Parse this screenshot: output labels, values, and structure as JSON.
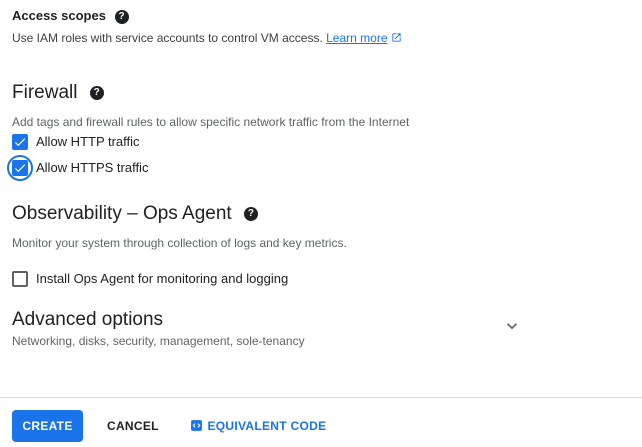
{
  "access_scopes": {
    "title": "Access scopes",
    "help_icon": "help-circle-icon",
    "description": "Use IAM roles with service accounts to control VM access.",
    "learn_more_label": "Learn more",
    "external_icon": "open-in-new-icon"
  },
  "firewall": {
    "title": "Firewall",
    "help_icon": "help-circle-icon",
    "description": "Add tags and firewall rules to allow specific network traffic from the Internet",
    "http": {
      "label": "Allow HTTP traffic",
      "checked": true
    },
    "https": {
      "label": "Allow HTTPS traffic",
      "checked": true
    }
  },
  "observability": {
    "title": "Observability – Ops Agent",
    "help_icon": "help-circle-icon",
    "description": "Monitor your system through collection of logs and key metrics.",
    "ops_agent": {
      "label": "Install Ops Agent for monitoring and logging",
      "checked": false
    }
  },
  "advanced": {
    "title": "Advanced options",
    "subtitle": "Networking, disks, security, management, sole-tenancy",
    "expand_icon": "chevron-down-icon"
  },
  "footer": {
    "create_label": "CREATE",
    "cancel_label": "CANCEL",
    "equivalent_code_label": "EQUIVALENT CODE",
    "code_icon": "code-icon"
  },
  "colors": {
    "accent": "#1a73e8",
    "text": "#202124",
    "muted": "#5f6368",
    "divider": "#dadce0"
  }
}
